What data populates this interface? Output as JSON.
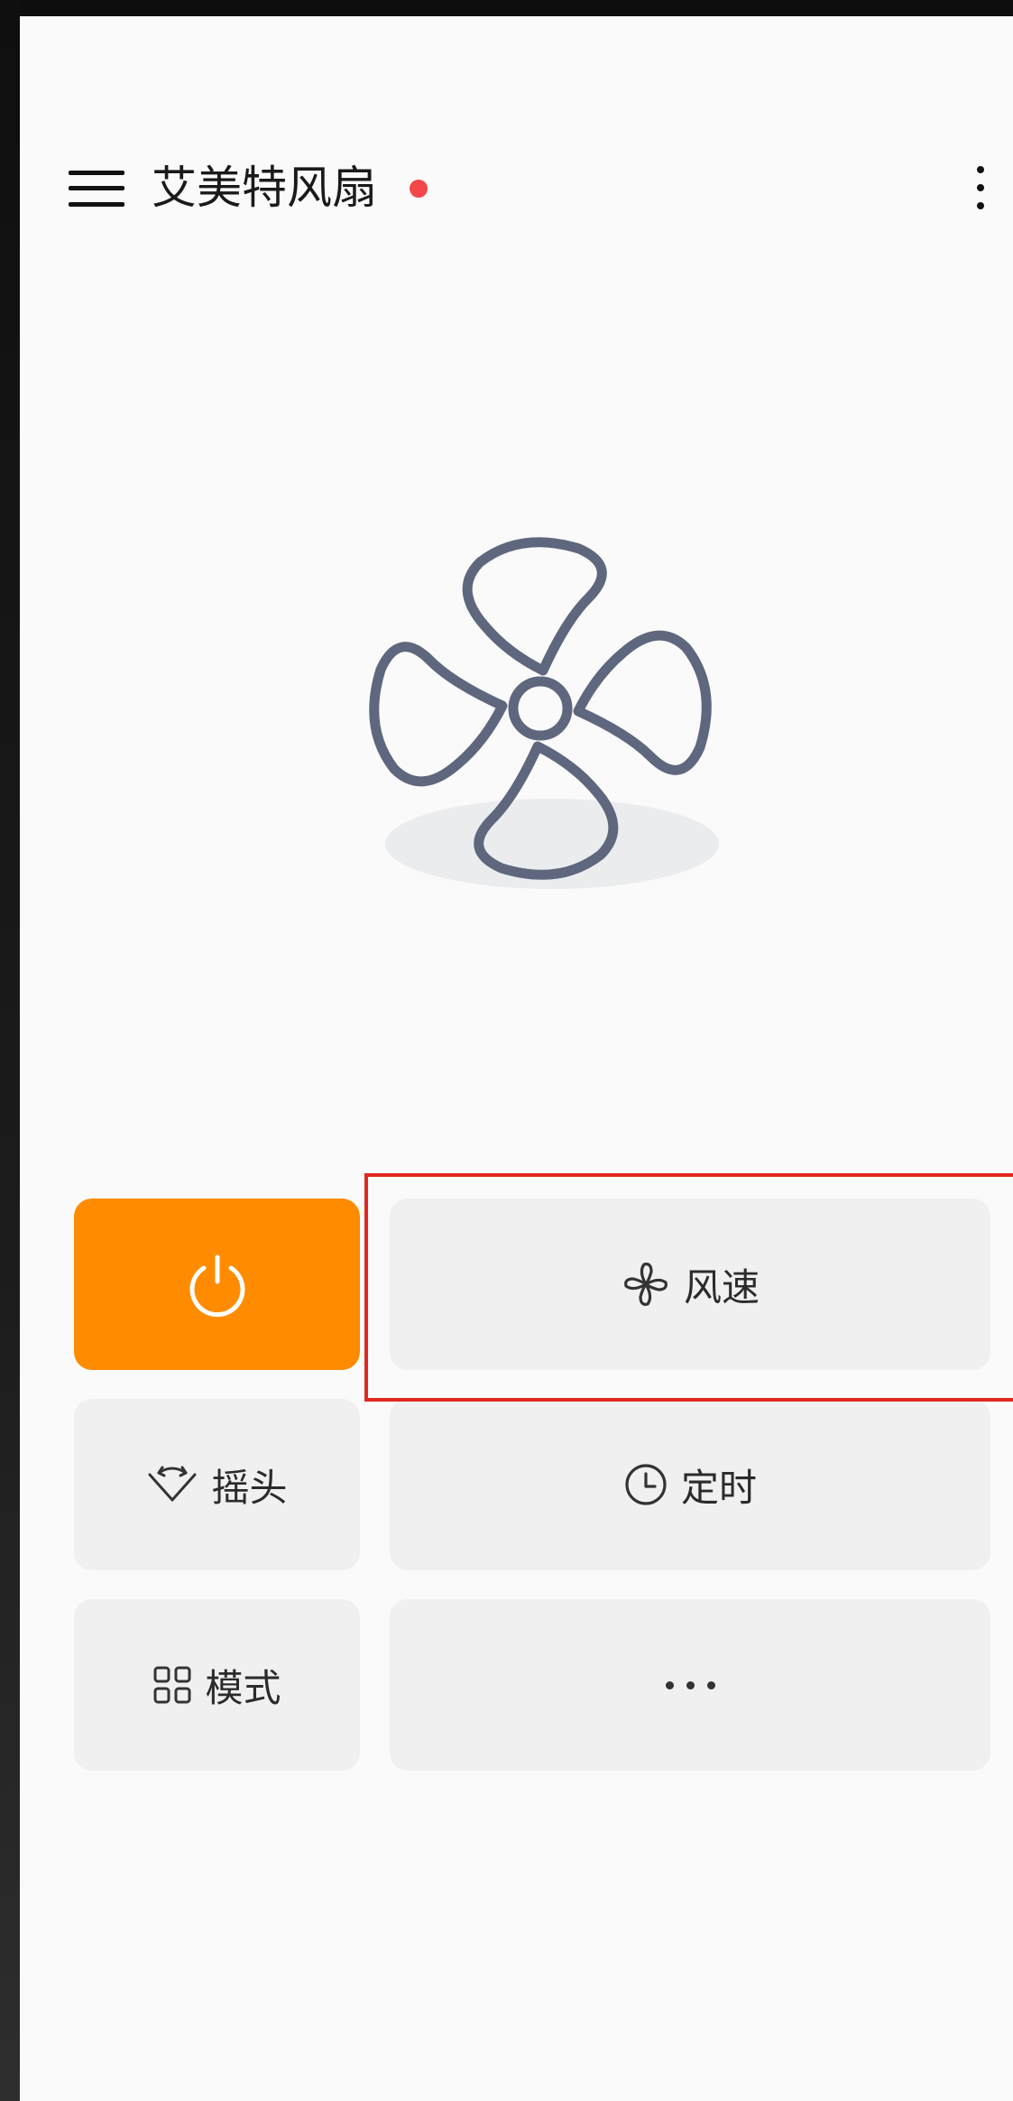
{
  "header": {
    "title": "艾美特风扇",
    "status_color": "#f44848"
  },
  "illustration": {
    "icon": "fan-icon",
    "color": "#5e677d"
  },
  "controls": {
    "power": {
      "icon": "power-icon",
      "color": "#ff8c00"
    },
    "speed": {
      "label": "风速",
      "icon": "fan-speed-icon"
    },
    "swing": {
      "label": "摇头",
      "icon": "swing-icon"
    },
    "timer": {
      "label": "定时",
      "icon": "clock-icon"
    },
    "mode": {
      "label": "模式",
      "icon": "grid-icon"
    },
    "more": {
      "icon": "ellipsis-icon"
    }
  },
  "highlight": {
    "target": "speed",
    "color": "#e0281e"
  }
}
